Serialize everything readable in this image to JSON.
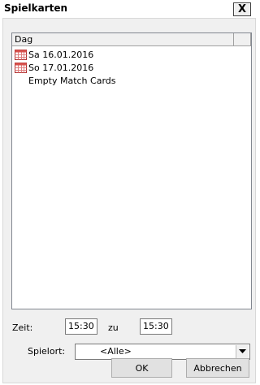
{
  "window": {
    "title": "Spielkarten",
    "close_label": "X"
  },
  "list": {
    "column_header": "Dag",
    "items": [
      {
        "label": "Sa 16.01.2016",
        "icon": "calendar-icon"
      },
      {
        "label": "So 17.01.2016",
        "icon": "calendar-icon"
      },
      {
        "label": "Empty Match Cards",
        "icon": ""
      }
    ]
  },
  "time": {
    "label": "Zeit:",
    "from": "15:30",
    "to_label": "zu",
    "to": "15:30"
  },
  "venue": {
    "label": "Spielort:",
    "selected": "<Alle>"
  },
  "buttons": {
    "ok": "OK",
    "cancel": "Abbrechen"
  },
  "colors": {
    "dialog_bg": "#f0f0f0",
    "list_bg": "#ffffff",
    "calendar_red": "#d9534f"
  }
}
